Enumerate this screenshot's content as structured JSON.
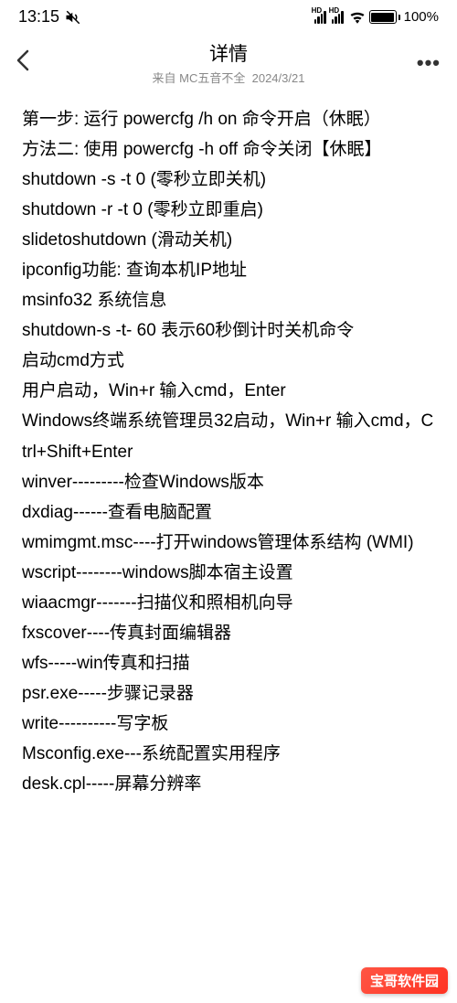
{
  "status": {
    "time": "13:15",
    "battery_pct": "100%"
  },
  "nav": {
    "title": "详情",
    "subtitle_prefix": "来自 ",
    "subtitle_author": "MC五音不全",
    "subtitle_date": "2024/3/21"
  },
  "content": {
    "lines": [
      "第一步: 运行 powercfg /h on 命令开启（休眠）",
      "方法二: 使用 powercfg -h off 命令关闭【休眠】",
      "shutdown -s -t 0 (零秒立即关机)",
      "shutdown -r -t 0 (零秒立即重启)",
      "slidetoshutdown (滑动关机)",
      "ipconfig功能: 查询本机IP地址",
      "msinfo32 系统信息",
      "shutdown-s -t- 60 表示60秒倒计时关机命令",
      "启动cmd方式",
      "用户启动，Win+r 输入cmd，Enter",
      "Windows终端系统管理员32启动，Win+r 输入cmd，Ctrl+Shift+Enter",
      "winver---------检查Windows版本",
      "dxdiag------查看电脑配置",
      "wmimgmt.msc----打开windows管理体系结构 (WMI)",
      "wscript--------windows脚本宿主设置",
      "wiaacmgr-------扫描仪和照相机向导",
      "fxscover----传真封面编辑器",
      "wfs-----win传真和扫描",
      "psr.exe-----步骤记录器",
      "write----------写字板",
      "Msconfig.exe---系统配置实用程序",
      "desk.cpl-----屏幕分辨率"
    ]
  },
  "watermark": "宝哥软件园"
}
